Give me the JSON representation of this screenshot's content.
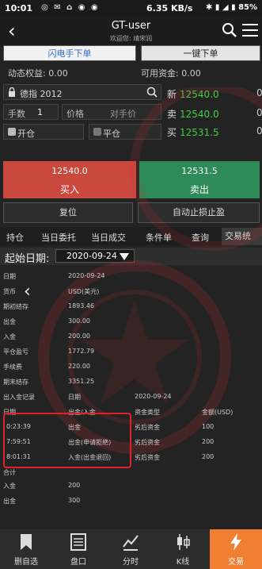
{
  "status": {
    "time": "10:01",
    "net": "6.35 KB/s",
    "battery": "85%"
  },
  "header": {
    "title": "GT-user",
    "subtitle": "欢迎您: 靖宋润"
  },
  "modes": {
    "flash": "闪电手下单",
    "onekey": "一键下单"
  },
  "account": {
    "equity_label": "动态权益",
    "equity": "0.00",
    "funds_label": "可用资金",
    "funds": "0.00"
  },
  "form": {
    "product": "德指 2012",
    "qty_label": "手数",
    "qty_value": "1",
    "price_label": "价格",
    "price_placeholder": "对手价",
    "open_label": "开仓",
    "close_label": "平仓"
  },
  "quotes": [
    {
      "label": "新",
      "value": "12540.0"
    },
    {
      "label": "卖",
      "value": "12540.0"
    },
    {
      "label": "买",
      "value": "12531.5"
    }
  ],
  "quote_edge": [
    "0",
    "0",
    "0"
  ],
  "trade": {
    "buy_price": "12540.0",
    "buy_label": "买入",
    "sell_price": "12531.5",
    "sell_label": "卖出",
    "reset_label": "复位",
    "auto_label": "自动止损止盈"
  },
  "tabs": [
    "持仓",
    "当日委托",
    "当日成交",
    "条件单",
    "查询",
    "交易统计"
  ],
  "date_filter": {
    "label": "起始日期:",
    "value": "2020-09-24"
  },
  "statement": [
    {
      "label": "日期",
      "value": "2020-09-24"
    },
    {
      "label": "货币",
      "value": "USD(美元)"
    },
    {
      "label": "期初结存",
      "value": "1893.46"
    },
    {
      "label": "出金",
      "value": "300.00"
    },
    {
      "label": "入金",
      "value": "200.00"
    },
    {
      "label": "平仓盈亏",
      "value": "1772.79"
    },
    {
      "label": "手续费",
      "value": "220.00"
    },
    {
      "label": "期末结存",
      "value": "3351.25"
    }
  ],
  "record": {
    "title": "出入金记录",
    "date_h": "日期",
    "date_v": "2020-09-24",
    "headers": [
      "日期",
      "出金/入金",
      "资金类型",
      "金额(USD)"
    ],
    "rows": [
      [
        "0:23:39",
        "出金",
        "劣后资金",
        "100"
      ],
      [
        "7:59:51",
        "出金(申请拒绝)",
        "劣后资金",
        "200"
      ],
      [
        "8:01:31",
        "入金(出金退回)",
        "劣后资金",
        "200"
      ]
    ],
    "total_label": "合计",
    "totals": [
      {
        "label": "入金",
        "value": "200"
      },
      {
        "label": "出金",
        "value": "300"
      }
    ]
  },
  "nav": [
    {
      "label": "删自选",
      "icon": "bookmark-icon"
    },
    {
      "label": "盘口",
      "icon": "orderbook-icon"
    },
    {
      "label": "分时",
      "icon": "timeshare-icon"
    },
    {
      "label": "K线",
      "icon": "candlestick-icon"
    },
    {
      "label": "交易",
      "icon": "bolt-icon"
    }
  ]
}
